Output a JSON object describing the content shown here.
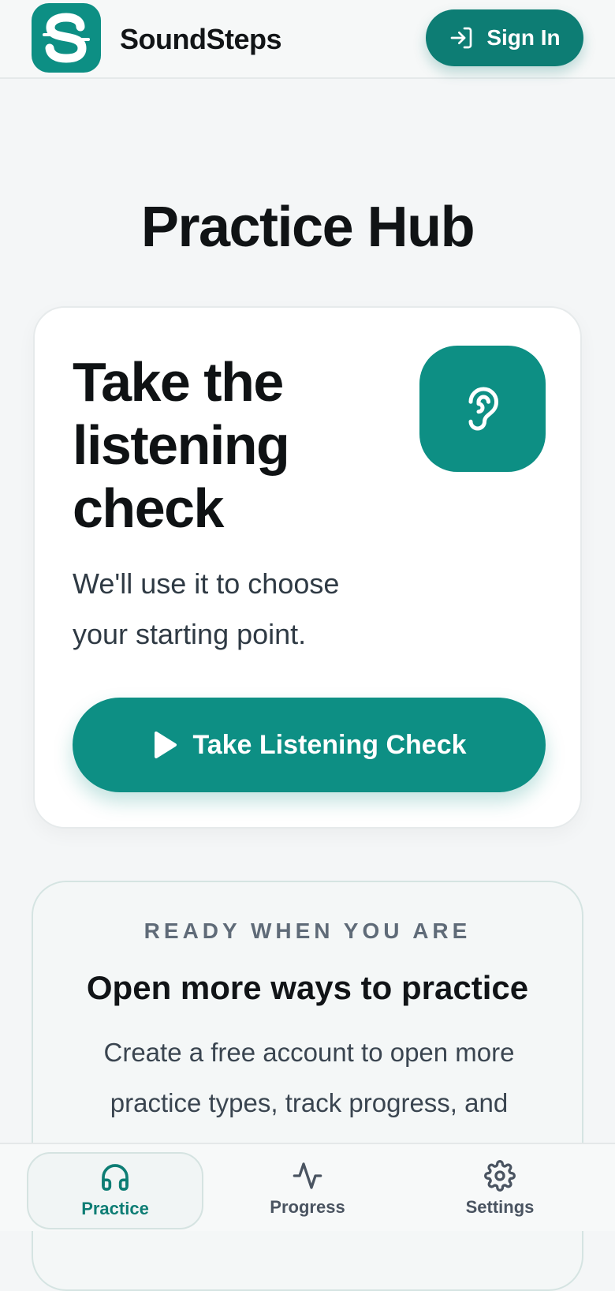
{
  "header": {
    "brand": "SoundSteps",
    "sign_in_label": "Sign In"
  },
  "page": {
    "title": "Practice Hub"
  },
  "listening_card": {
    "title": "Take the listening check",
    "description": "We'll use it to choose your starting point.",
    "button_label": "Take Listening Check",
    "icon": "ear-icon"
  },
  "promo": {
    "eyebrow": "READY WHEN YOU ARE",
    "title": "Open more ways to practice",
    "description": "Create a free account to open more practice types, track progress, and"
  },
  "tabbar": {
    "items": [
      {
        "label": "Practice",
        "icon": "headphones-icon",
        "active": true
      },
      {
        "label": "Progress",
        "icon": "activity-icon",
        "active": false
      },
      {
        "label": "Settings",
        "icon": "gear-icon",
        "active": false
      }
    ]
  },
  "colors": {
    "accent": "#0d8f84",
    "accent_dark": "#0d7d74",
    "background": "#f4f6f7"
  }
}
